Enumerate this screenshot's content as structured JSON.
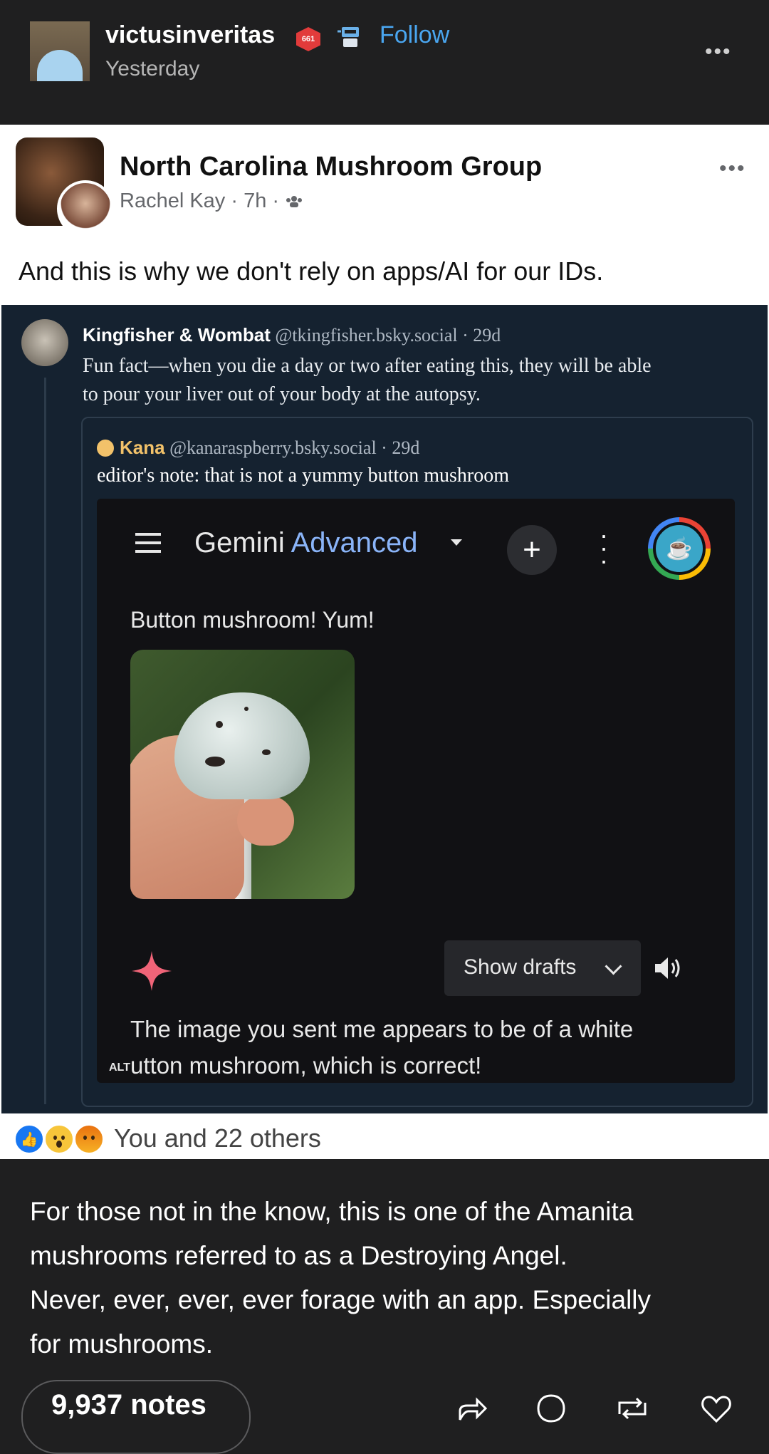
{
  "post": {
    "username": "victusinveritas",
    "badge_text": "661",
    "follow_label": "Follow",
    "timestamp": "Yesterday",
    "more": "•••"
  },
  "facebook": {
    "group_name": "North Carolina Mushroom Group",
    "author": "Rachel Kay",
    "time": "7h",
    "more": "•••",
    "text": "And this is why we don't rely on apps/AI for our IDs.",
    "reactions_text": "You and 22 others"
  },
  "bluesky": {
    "author_name": "Kingfisher & Wombat",
    "author_meta": "@tkingfisher.bsky.social · 29d",
    "body_line1": "Fun fact—when you die a day or two after eating this, they will be able",
    "body_line2": "to pour your liver out of your body at the autopsy.",
    "quote_name": "Kana",
    "quote_meta": "@kanaraspberry.bsky.social · 29d",
    "quote_body": "editor's note: that is not a yummy button mushroom"
  },
  "gemini": {
    "title": "Gemini",
    "title_accent": "Advanced",
    "prompt": "Button mushroom! Yum!",
    "show_drafts": "Show drafts",
    "response_line1": "The image you sent me appears to be of a white",
    "response_line2": "utton mushroom, which is correct!",
    "alt_badge": "ALT"
  },
  "caption": {
    "line1": "For those not in the know, this is one of the Amanita",
    "line2": "mushrooms referred to as a Destroying Angel.",
    "line3": "Never, ever, ever, ever forage with an app. Especially",
    "line4": "for mushrooms."
  },
  "footer": {
    "notes": "9,937 notes"
  },
  "colors": {
    "tumblr_bg": "#1f1f20",
    "follow": "#4aa6f0",
    "bluesky_bg": "#152230",
    "gemini_accent": "#8ab4f8",
    "fb_like": "#1877f2"
  },
  "icons": [
    "share-icon",
    "reply-icon",
    "reblog-icon",
    "like-icon"
  ]
}
